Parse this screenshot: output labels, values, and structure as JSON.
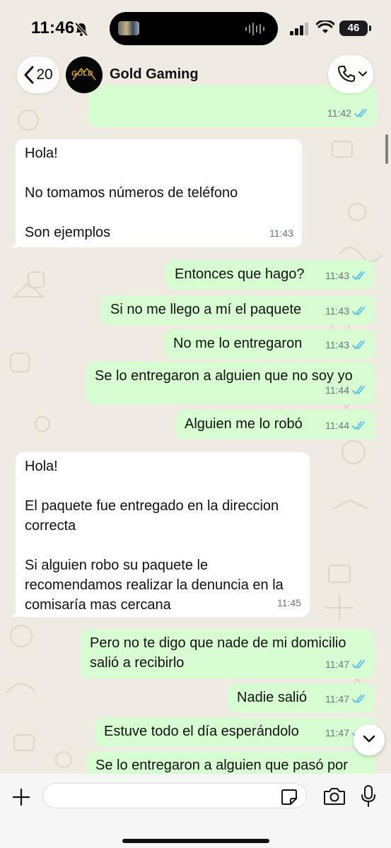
{
  "status_bar": {
    "time": "11:46",
    "battery": "46"
  },
  "header": {
    "back_count": "20",
    "avatar_text": "GOLD",
    "contact_name": "Gold Gaming"
  },
  "colors": {
    "outgoing": "#d9fdd3",
    "incoming": "#ffffff",
    "read_ticks": "#53bdeb",
    "background": "#efeae2"
  },
  "messages": [
    {
      "dir": "out",
      "text": "",
      "time": "11:42",
      "read": true
    },
    {
      "dir": "in",
      "text": "Hola!\n\nNo tomamos números de teléfono\n\nSon ejemplos",
      "time": "11:43"
    },
    {
      "dir": "out",
      "text": "Entonces que hago?",
      "time": "11:43",
      "read": true
    },
    {
      "dir": "out",
      "text": "Si no me llego a mí el paquete",
      "time": "11:43",
      "read": true
    },
    {
      "dir": "out",
      "text": "No me lo entregaron",
      "time": "11:43",
      "read": true
    },
    {
      "dir": "out",
      "text": "Se lo entregaron a alguien que no soy yo",
      "time": "11:44",
      "read": true
    },
    {
      "dir": "out",
      "text": "Alguien me lo robó",
      "time": "11:44",
      "read": true
    },
    {
      "dir": "in",
      "text": "Hola!\n\nEl paquete fue entregado en la direccion\ncorrecta\n\nSi alguien robo su paquete le\nrecomendamos realizar la denuncia en la\ncomisaría mas cercana",
      "time": "11:45"
    },
    {
      "dir": "out",
      "text": "Pero no te digo que nade de mi domicilio\nsalió a recibirlo",
      "time": "11:47",
      "read": true
    },
    {
      "dir": "out",
      "text": "Nadie salió",
      "time": "11:47",
      "read": true
    },
    {
      "dir": "out",
      "text": "Estuve todo el día esperándolo",
      "time": "11:47",
      "read": true
    },
    {
      "dir": "out",
      "text": "Se lo entregaron a alguien que pasó por",
      "time": "",
      "read": false
    }
  ],
  "composer": {
    "placeholder": ""
  },
  "icons": {
    "back": "chevron-left-icon",
    "call": "phone-icon",
    "call_menu": "chevron-down-icon",
    "attach": "plus-icon",
    "sticker": "sticker-icon",
    "camera": "camera-icon",
    "mic": "microphone-icon",
    "scroll": "chevron-down-icon",
    "read": "double-check-icon"
  }
}
